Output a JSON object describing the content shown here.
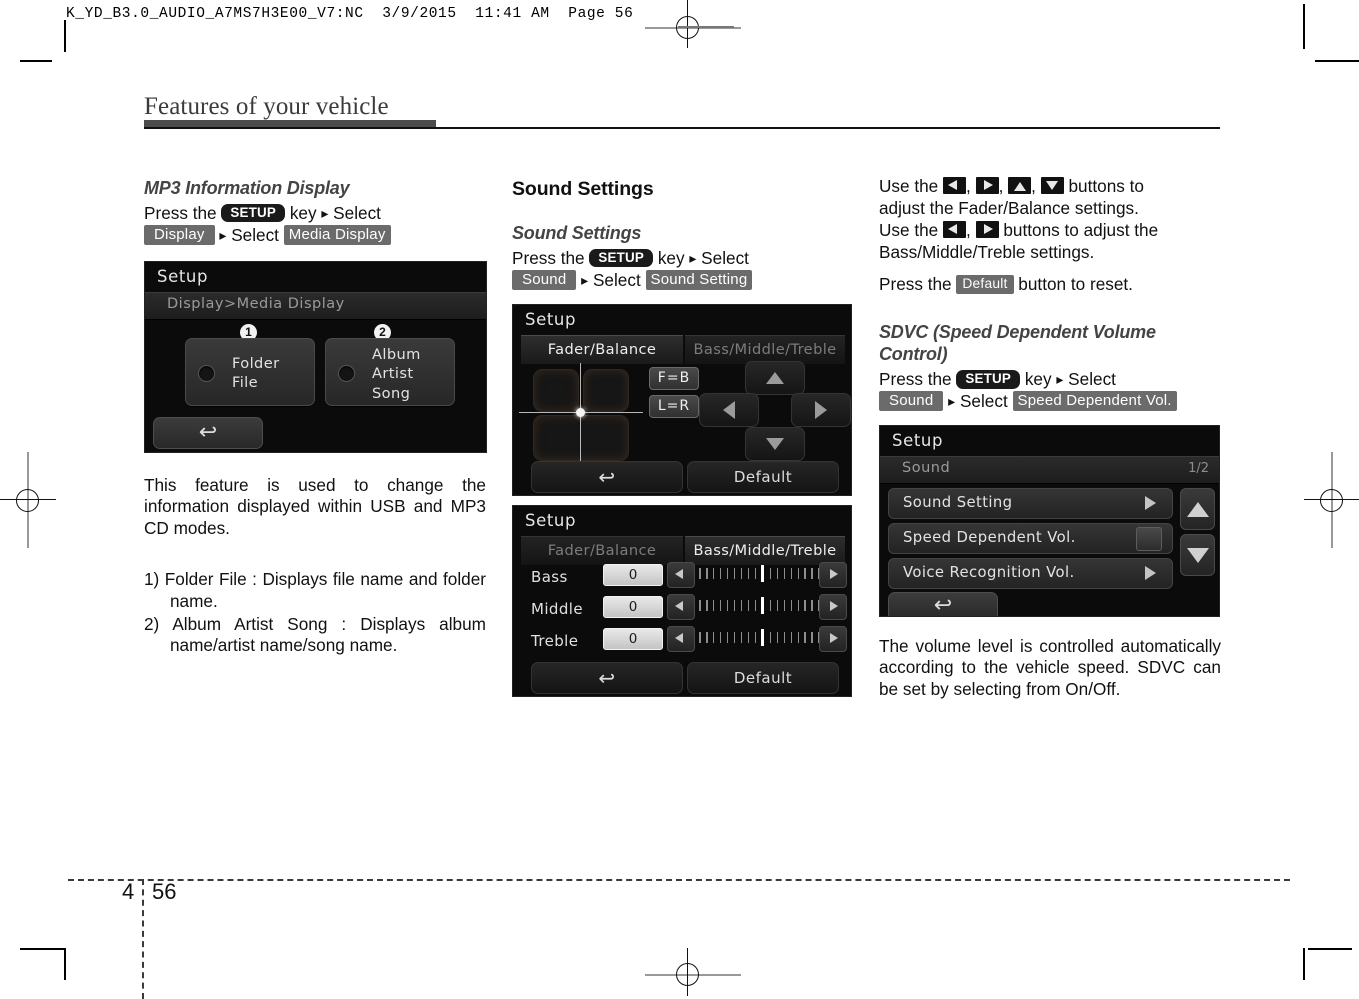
{
  "prepress": {
    "header_line": "K_YD_B3.0_AUDIO_A7MS7H3E00_V7:NC  3/9/2015  11:41 AM  Page 56"
  },
  "running_head": {
    "chapter_title": "Features of your vehicle"
  },
  "footer": {
    "chapter_number": "4",
    "page_number": "56"
  },
  "left_column": {
    "heading": "MP3 Information Display",
    "instruction": {
      "press_the": "Press  the",
      "key_chip": "SETUP",
      "key_word": "key",
      "select_1": "Select",
      "chip_display": "Display",
      "select_2": "Select",
      "chip_media_display": "Media Display"
    },
    "screenshot": {
      "title": "Setup",
      "breadcrumb": "Display>Media Display",
      "option1_number": "1",
      "option1_line1": "Folder",
      "option1_line2": "File",
      "option2_number": "2",
      "option2_line1": "Album",
      "option2_line2": "Artist",
      "option2_line3": "Song",
      "back_icon": "back-arrow-icon"
    },
    "description": "This feature is used to change the information displayed within USB and MP3 CD modes.",
    "list": [
      "1) Folder File : Displays file name and folder name.",
      "2) Album Artist Song : Displays album name/artist name/song name."
    ]
  },
  "middle_column": {
    "heading": "Sound Settings",
    "subheading": "Sound Settings",
    "instruction": {
      "press_the": "Press  the",
      "key_chip": "SETUP",
      "key_word": "key",
      "select_1": "Select",
      "chip_sound": "Sound",
      "select_2": "Select",
      "chip_sound_setting": "Sound Setting"
    },
    "screenshot_fader": {
      "title": "Setup",
      "tab_active": "Fader/Balance",
      "tab_inactive": "Bass/Middle/Treble",
      "btn_fb": "F=B",
      "btn_lr": "L=R",
      "back_icon": "back-arrow-icon",
      "default_label": "Default"
    },
    "screenshot_tone": {
      "title": "Setup",
      "tab_inactive": "Fader/Balance",
      "tab_active": "Bass/Middle/Treble",
      "rows": [
        {
          "label": "Bass",
          "value": "0"
        },
        {
          "label": "Middle",
          "value": "0"
        },
        {
          "label": "Treble",
          "value": "0"
        }
      ],
      "back_icon": "back-arrow-icon",
      "default_label": "Default"
    }
  },
  "right_column": {
    "para1": {
      "use_the": "Use  the",
      "comma": ",",
      "buttons_to": "buttons  to",
      "line2": "adjust the Fader/Balance settings.",
      "use_the_2": "Use the",
      "buttons_to_adjust": "buttons to adjust the",
      "line4": "Bass/Middle/Treble settings.",
      "press_the": "Press the",
      "chip_default": "Default",
      "button_to_reset": "button to reset."
    },
    "sdvc_heading_line1": "SDVC (Speed Dependent Volume",
    "sdvc_heading_line2": "Control)",
    "sdvc_instruction": {
      "press_the": "Press  the",
      "key_chip": "SETUP",
      "key_word": "key",
      "select_1": "Select",
      "chip_sound": "Sound",
      "select_2": "Select",
      "chip_speed_dependent": "Speed Dependent Vol."
    },
    "screenshot_sound_menu": {
      "title": "Setup",
      "breadcrumb": "Sound",
      "page_indicator": "1/2",
      "rows": [
        {
          "label": "Sound Setting",
          "control": "chevron"
        },
        {
          "label": "Speed Dependent Vol.",
          "control": "checkbox"
        },
        {
          "label": "Voice Recognition Vol.",
          "control": "chevron"
        }
      ],
      "back_icon": "back-arrow-icon",
      "scroll_up_icon": "triangle-up-icon",
      "scroll_down_icon": "triangle-down-icon"
    },
    "sdvc_description": "The volume level is controlled automatically according to the vehicle speed. SDVC can be set by selecting from On/Off."
  },
  "colors": {
    "chip_dark": "#1a1a1a",
    "chip_gray": "#6b6b6b",
    "rule_dark": "#4d4d4d",
    "screen_bg": "#0b0b0b"
  }
}
